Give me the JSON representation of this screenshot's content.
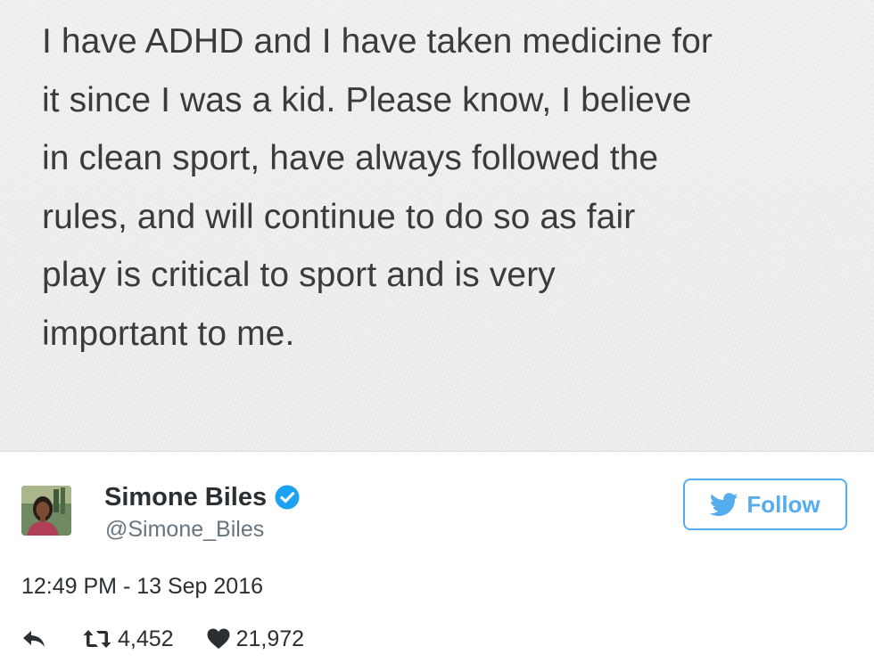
{
  "note": {
    "text": "I have ADHD and I have taken medicine for\nit since I was a kid. Please know, I believe\nin clean sport, have always followed the\nrules, and will continue to do so as fair\nplay is critical to sport and is very\nimportant to me."
  },
  "user": {
    "display_name": "Simone Biles",
    "handle": "@Simone_Biles",
    "verified": true
  },
  "follow_button": {
    "label": "Follow"
  },
  "tweet": {
    "timestamp": "12:49 PM - 13 Sep 2016",
    "retweets": "4,452",
    "likes": "21,972"
  },
  "icons": {
    "reply": "reply-icon",
    "retweet": "retweet-icon",
    "like": "heart-icon",
    "verified": "verified-badge-icon",
    "follow": "twitter-bird-icon"
  },
  "colors": {
    "accent": "#55acee",
    "verified": "#1da1f2",
    "text_primary": "#292f33",
    "text_secondary": "#66757f",
    "note_text": "#3b3b3b",
    "note_background": "#ededed"
  }
}
